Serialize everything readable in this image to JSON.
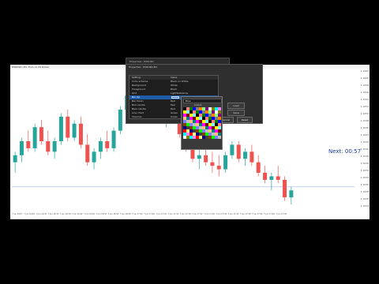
{
  "window": {
    "title": "EURUSD, M1: Euro vs US Dollar"
  },
  "countdown": "Next: 00:57",
  "chart_data": {
    "type": "candlestick",
    "price_labels": [
      "1.1062",
      "1.1060",
      "1.1058",
      "1.1056",
      "1.1054",
      "1.1052",
      "1.1050",
      "1.1048",
      "1.1046",
      "1.1044",
      "1.1042",
      "1.1040",
      "1.1038",
      "1.1036",
      "1.1034",
      "1.1032",
      "1.1030",
      "1.1028",
      "1.1026",
      "1.1024"
    ],
    "time_labels": [
      "7 Jun 2023",
      "7 Jun 16:26",
      "7 Jun 16:30",
      "7 Jun 16:34",
      "7 Jun 16:38",
      "7 Jun 16:42",
      "7 Jun 16:46",
      "7 Jun 16:50",
      "7 Jun 16:54",
      "7 Jun 16:58",
      "7 Jun 17:02",
      "7 Jun 17:06",
      "7 Jun 17:10",
      "7 Jun 17:14",
      "7 Jun 17:18",
      "7 Jun 17:22",
      "7 Jun 17:26",
      "7 Jun 17:30",
      "7 Jun 17:34",
      "7 Jun 17:38",
      "7 Jun 17:42",
      "7 Jun 17:46",
      "7 Jun 17:50"
    ],
    "candles": [
      {
        "o": 1.1037,
        "h": 1.104,
        "l": 1.1034,
        "c": 1.1039
      },
      {
        "o": 1.1039,
        "h": 1.1044,
        "l": 1.1037,
        "c": 1.1043
      },
      {
        "o": 1.1043,
        "h": 1.1046,
        "l": 1.104,
        "c": 1.1041
      },
      {
        "o": 1.1041,
        "h": 1.1048,
        "l": 1.104,
        "c": 1.1047
      },
      {
        "o": 1.1047,
        "h": 1.1049,
        "l": 1.1042,
        "c": 1.1043
      },
      {
        "o": 1.1043,
        "h": 1.1046,
        "l": 1.1039,
        "c": 1.104
      },
      {
        "o": 1.104,
        "h": 1.1044,
        "l": 1.1038,
        "c": 1.1043
      },
      {
        "o": 1.1043,
        "h": 1.1051,
        "l": 1.1042,
        "c": 1.105
      },
      {
        "o": 1.105,
        "h": 1.1052,
        "l": 1.1043,
        "c": 1.1044
      },
      {
        "o": 1.1044,
        "h": 1.1049,
        "l": 1.1043,
        "c": 1.1048
      },
      {
        "o": 1.1048,
        "h": 1.105,
        "l": 1.1041,
        "c": 1.1042
      },
      {
        "o": 1.1042,
        "h": 1.1045,
        "l": 1.1036,
        "c": 1.1037
      },
      {
        "o": 1.1037,
        "h": 1.1041,
        "l": 1.1035,
        "c": 1.104
      },
      {
        "o": 1.104,
        "h": 1.1044,
        "l": 1.1038,
        "c": 1.1043
      },
      {
        "o": 1.1043,
        "h": 1.1046,
        "l": 1.104,
        "c": 1.1041
      },
      {
        "o": 1.1041,
        "h": 1.1047,
        "l": 1.104,
        "c": 1.1046
      },
      {
        "o": 1.1046,
        "h": 1.1053,
        "l": 1.1045,
        "c": 1.1052
      },
      {
        "o": 1.1052,
        "h": 1.1057,
        "l": 1.1051,
        "c": 1.1056
      },
      {
        "o": 1.1056,
        "h": 1.1058,
        "l": 1.1053,
        "c": 1.1055
      },
      {
        "o": 1.1055,
        "h": 1.1059,
        "l": 1.1054,
        "c": 1.1058
      },
      {
        "o": 1.1058,
        "h": 1.1062,
        "l": 1.1057,
        "c": 1.1061
      },
      {
        "o": 1.1061,
        "h": 1.1062,
        "l": 1.1052,
        "c": 1.1053
      },
      {
        "o": 1.1053,
        "h": 1.1055,
        "l": 1.1048,
        "c": 1.1049
      },
      {
        "o": 1.1049,
        "h": 1.1053,
        "l": 1.1047,
        "c": 1.1052
      },
      {
        "o": 1.1052,
        "h": 1.1054,
        "l": 1.1048,
        "c": 1.1049
      },
      {
        "o": 1.1049,
        "h": 1.1051,
        "l": 1.1044,
        "c": 1.1045
      },
      {
        "o": 1.1045,
        "h": 1.1047,
        "l": 1.104,
        "c": 1.1041
      },
      {
        "o": 1.1041,
        "h": 1.1043,
        "l": 1.1037,
        "c": 1.1038
      },
      {
        "o": 1.1038,
        "h": 1.1041,
        "l": 1.1035,
        "c": 1.1039
      },
      {
        "o": 1.1039,
        "h": 1.1042,
        "l": 1.1036,
        "c": 1.1037
      },
      {
        "o": 1.1037,
        "h": 1.104,
        "l": 1.1034,
        "c": 1.1036
      },
      {
        "o": 1.1036,
        "h": 1.1039,
        "l": 1.1033,
        "c": 1.1035
      },
      {
        "o": 1.1035,
        "h": 1.104,
        "l": 1.1034,
        "c": 1.1039
      },
      {
        "o": 1.1039,
        "h": 1.1043,
        "l": 1.1038,
        "c": 1.1042
      },
      {
        "o": 1.1042,
        "h": 1.1043,
        "l": 1.1037,
        "c": 1.1038
      },
      {
        "o": 1.1038,
        "h": 1.1041,
        "l": 1.1036,
        "c": 1.104
      },
      {
        "o": 1.104,
        "h": 1.1042,
        "l": 1.1036,
        "c": 1.1037
      },
      {
        "o": 1.1037,
        "h": 1.1039,
        "l": 1.1033,
        "c": 1.1034
      },
      {
        "o": 1.1034,
        "h": 1.1036,
        "l": 1.1031,
        "c": 1.1032
      },
      {
        "o": 1.1032,
        "h": 1.1034,
        "l": 1.1029,
        "c": 1.1033
      },
      {
        "o": 1.1033,
        "h": 1.1036,
        "l": 1.1031,
        "c": 1.1032
      },
      {
        "o": 1.1032,
        "h": 1.1033,
        "l": 1.1026,
        "c": 1.1027
      },
      {
        "o": 1.1027,
        "h": 1.103,
        "l": 1.1025,
        "c": 1.1029
      }
    ],
    "bid_line": 1.103,
    "colors": {
      "bull": "#26a69a",
      "bear": "#ef5350",
      "bid_line": "#9fb4e6"
    }
  },
  "dialog_back": {
    "title": "Properties - EURUSD",
    "input_value": "Template",
    "button_label": "Save"
  },
  "dialog_main": {
    "title": "Properties - EURUSD,M1",
    "tabs": [
      "Common",
      "Show",
      "Colors",
      "Visualization"
    ],
    "active_tab": "Colors",
    "header_name": "Setting",
    "header_value": "Value",
    "rows": [
      {
        "label": "Color scheme",
        "value": "Black on White"
      },
      {
        "label": "Background",
        "value": "White"
      },
      {
        "label": "Foreground",
        "value": "Black"
      },
      {
        "label": "Grid",
        "value": "LightSlateGray"
      },
      {
        "label": "Bar Up",
        "value": "Teal"
      },
      {
        "label": "Bar Down",
        "value": "Red"
      },
      {
        "label": "Bull candle",
        "value": "Teal"
      },
      {
        "label": "Bear candle",
        "value": "Red"
      },
      {
        "label": "Line chart",
        "value": "Green"
      },
      {
        "label": "Volumes",
        "value": "Green"
      }
    ],
    "selected_row": 4,
    "buttons": {
      "load": "Load",
      "save": "Save",
      "ok": "OK",
      "cancel": "Cancel",
      "reset": "Reset"
    }
  },
  "color_picker": {
    "current": "Blue",
    "title": "Colors",
    "palette": [
      "#000000",
      "#404040",
      "#808080",
      "#c0c0c0",
      "#ffffff",
      "#800000",
      "#ff0000",
      "#ff8080",
      "#804000",
      "#ff8000",
      "#ffc080",
      "#808000",
      "#ffff00",
      "#ffff80",
      "#008000",
      "#00ff00",
      "#80ff80",
      "#008080",
      "#00ffff",
      "#80ffff",
      "#000080",
      "#0000ff",
      "#8080ff",
      "#800080",
      "#ff00ff",
      "#ff80ff"
    ]
  }
}
